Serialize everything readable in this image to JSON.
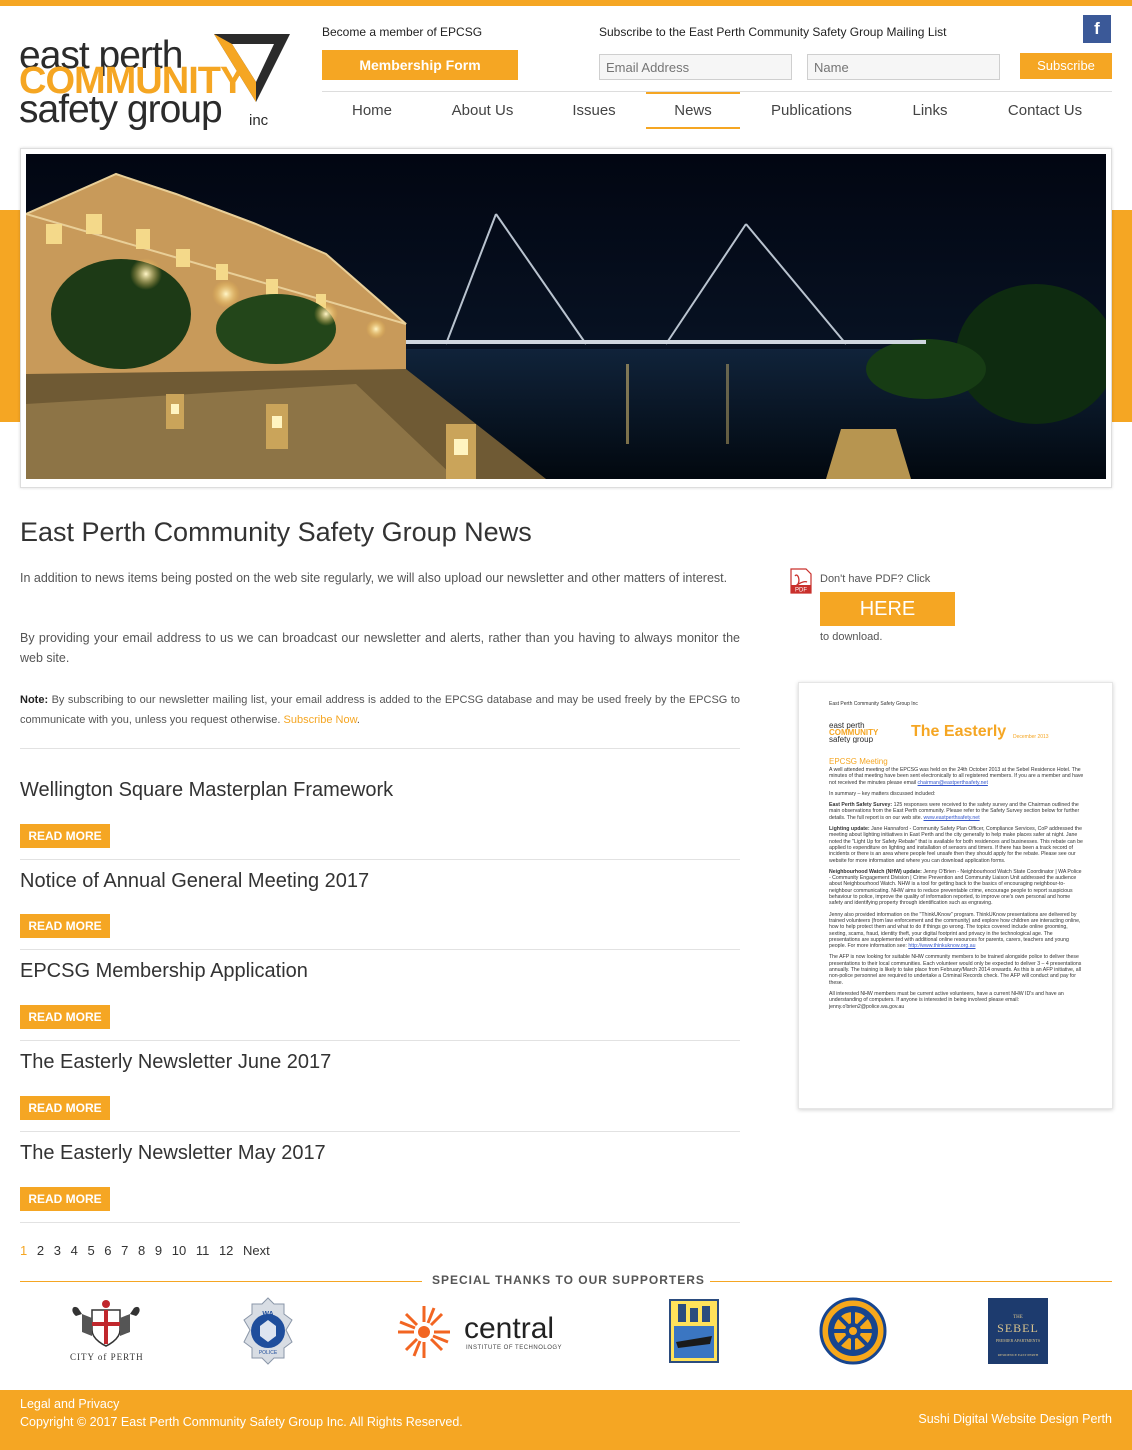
{
  "colors": {
    "accent": "#f5a623",
    "text": "#333333",
    "facebook": "#3b5998"
  },
  "logo": {
    "line1": "east perth",
    "line2": "COMMUNITY",
    "line3": "safety group",
    "suffix": "inc"
  },
  "membership": {
    "prompt": "Become a member of EPCSG",
    "button": "Membership Form"
  },
  "subscribe": {
    "prompt": "Subscribe to the East Perth Community Safety Group Mailing List",
    "email_placeholder": "Email Address",
    "name_placeholder": "Name",
    "button": "Subscribe"
  },
  "social": {
    "facebook_icon": "f"
  },
  "nav": {
    "items": [
      {
        "label": "Home"
      },
      {
        "label": "About Us"
      },
      {
        "label": "Issues"
      },
      {
        "label": "News",
        "active": true
      },
      {
        "label": "Publications"
      },
      {
        "label": "Links"
      },
      {
        "label": "Contact Us"
      }
    ]
  },
  "main": {
    "title": "East Perth Community Safety Group News",
    "para1": "In addition to news items being posted on the web site regularly, we will also upload our newsletter and other matters of interest.",
    "para2": "By providing your email address to us we can broadcast our newsletter and alerts, rather than you having to always monitor the web site.",
    "note_label": "Note:",
    "note_text": " By subscribing to our newsletter mailing list, your email address is added to the EPCSG database and may be used freely by the EPCSG to communicate with you, unless you request otherwise. ",
    "note_link": "Subscribe Now",
    "note_end": ".",
    "read_more_label": "READ MORE",
    "news": [
      {
        "title": "Wellington Square Masterplan Framework"
      },
      {
        "title": "Notice of Annual General Meeting 2017"
      },
      {
        "title": "EPCSG Membership Application"
      },
      {
        "title": "The Easterly Newsletter June 2017"
      },
      {
        "title": "The Easterly Newsletter May 2017"
      }
    ],
    "pagination": {
      "current": "1",
      "pages": [
        "2",
        "3",
        "4",
        "5",
        "6",
        "7",
        "8",
        "9",
        "10",
        "11",
        "12"
      ],
      "next": "Next"
    }
  },
  "sidebar": {
    "pdf_icon": "pdf-icon",
    "pdf_icon_label": "PDF",
    "pdf_prompt": "Don't have PDF? Click",
    "here_button": "HERE",
    "pdf_after": "to download.",
    "newsletter": {
      "header_small": "East Perth Community Safety Group Inc",
      "logo_line1": "east perth",
      "logo_line2": "COMMUNITY",
      "logo_line3": "safety group",
      "title": "The Easterly",
      "date": "December 2013",
      "heading": "EPCSG Meeting",
      "p1": "A well attended meeting of the EPCSG was held on the 24th October 2013 at the Sebel Residence Hotel. The minutes of that meeting have been sent electronically to all registered members. If you are a member and have not received the minutes please email",
      "p1_link": "chairman@eastperthsafety.net",
      "p2": "In summary – key matters discussed included:",
      "p3_label": "East Perth Safety Survey:",
      "p3": " 125 responses were received to the safety survey and the Chairman outlined the main observations from the East Perth community. Please refer to the Safety Survey section below for further details. The full report is on our web site.",
      "p3_link": "www.eastperthsafety.net",
      "p4_label": "Lighting update:",
      "p4": " Jane Hannaford - Community Safety Plan Officer, Compliance Services, CoP addressed the meeting about lighting initiatives in East Perth and the city generally to help make places safer at night. Jane noted the \"Light Up for Safety Rebate\" that is available for both residences and businesses. This rebate can be applied to expenditure on lighting and installation of sensors and timers. If there has been a track record of incidents or there is an area where people feel unsafe then they should apply for the rebate. Please see our website for more information and where you can download application forms.",
      "p5_label": "Neighbourhood Watch (NHW) update:",
      "p5": " Jenny O'Brien - Neighbourhood Watch State Coordinator | WA Police - Community Engagement Division | Crime Prevention and Community Liaison Unit addressed the audience about Neighbourhood Watch. NHW is a tool for getting back to the basics of encouraging neighbour-to-neighbour communicating. NHW aims to reduce preventable crime, encourage people to report suspicious behaviour to police, improve the quality of information reported, to improve one's own personal and home safety and identifying property through identification such as engraving.",
      "p6": "Jenny also provided information on the \"ThinkUKnow\" program. ThinkUKnow presentations are delivered by trained volunteers (from law enforcement and the community) and explore how children are interacting online, how to help protect them and what to do if things go wrong. The topics covered include online grooming, sexting, scams, fraud, identity theft, your digital footprint and privacy in the technological age. The presentations are supplemented with additional online resources for parents, carers, teachers and young people. For more information see:",
      "p6_link": "http://www.thinkuknow.org.au",
      "p7": "The AFP is now looking for suitable NHW community members to be trained alongside police to deliver these presentations to their local communities. Each volunteer would only be expected to deliver 3 – 4 presentations annually. The training is likely to take place from February/March 2014 onwards. As this is an AFP initiative, all non-police personnel are required to undertake a Criminal Records check. The AFP will conduct and pay for these.",
      "p8": "All interested NHW members must be current active volunteers, have a current NHW ID's and have an understanding of computers. If anyone is interested in being involved please email: jenny.o'brien2@police.wa.gov.au"
    }
  },
  "supporters": {
    "title": "SPECIAL THANKS TO OUR SUPPORTERS",
    "city_label": "CITY of PERTH",
    "wa_top": "WA",
    "wa_bottom": "POLICE",
    "central_name": "central",
    "central_sub": "INSTITUTE OF TECHNOLOGY",
    "sebel_name": "SEBEL",
    "sebel_the": "THE",
    "sebel_sub": "PREMIER APARTMENTS",
    "sebel_loc": "RESIDENCE EAST PERTH"
  },
  "footer": {
    "legal": "Legal and Privacy",
    "copyright": "Copyright © 2017 East Perth Community Safety Group Inc. All Rights Reserved.",
    "credit": "Sushi Digital Website Design Perth"
  }
}
